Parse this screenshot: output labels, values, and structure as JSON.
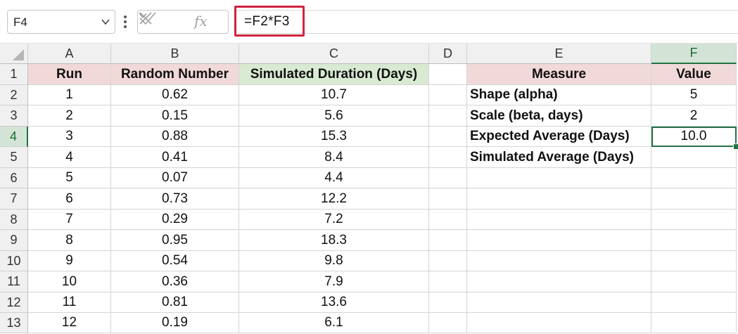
{
  "name_box": {
    "value": "F4"
  },
  "formula_bar": {
    "formula": "=F2*F3",
    "fx_label": "fx"
  },
  "columns": [
    "A",
    "B",
    "C",
    "D",
    "E",
    "F"
  ],
  "selected_column": "F",
  "rows": [
    "1",
    "2",
    "3",
    "4",
    "5",
    "6",
    "7",
    "8",
    "9",
    "10",
    "11",
    "12",
    "13"
  ],
  "selected_row": "4",
  "sim_table": {
    "headers": [
      "Run",
      "Random Number",
      "Simulated Duration (Days)"
    ],
    "rows": [
      [
        "1",
        "0.62",
        "10.7"
      ],
      [
        "2",
        "0.15",
        "5.6"
      ],
      [
        "3",
        "0.88",
        "15.3"
      ],
      [
        "4",
        "0.41",
        "8.4"
      ],
      [
        "5",
        "0.07",
        "4.4"
      ],
      [
        "6",
        "0.73",
        "12.2"
      ],
      [
        "7",
        "0.29",
        "7.2"
      ],
      [
        "8",
        "0.95",
        "18.3"
      ],
      [
        "9",
        "0.54",
        "9.8"
      ],
      [
        "10",
        "0.36",
        "7.9"
      ],
      [
        "11",
        "0.81",
        "13.6"
      ],
      [
        "12",
        "0.19",
        "6.1"
      ]
    ]
  },
  "measure_table": {
    "headers": [
      "Measure",
      "Value"
    ],
    "rows": [
      [
        "Shape (alpha)",
        "5"
      ],
      [
        "Scale (beta, days)",
        "2"
      ],
      [
        "Expected Average (Days)",
        "10.0"
      ],
      [
        "Simulated Average (Days)",
        ""
      ]
    ]
  },
  "colors": {
    "accent": "#217346",
    "highlight_border": "#d1233f",
    "header_pink": "#f2d9d9",
    "header_green": "#d9ead3"
  }
}
